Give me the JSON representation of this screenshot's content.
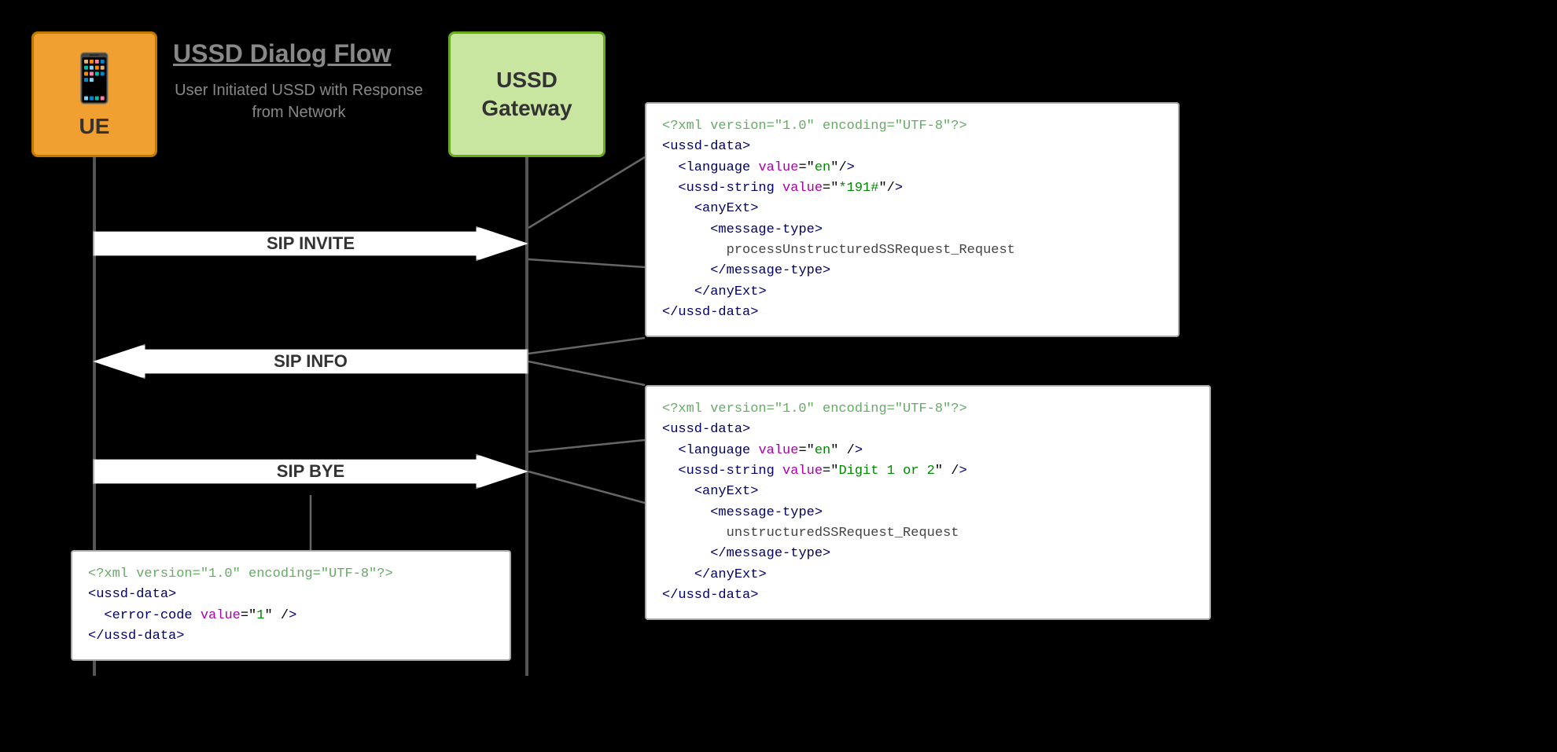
{
  "ue": {
    "label": "UE"
  },
  "title": {
    "main": "USSD Dialog Flow",
    "sub": "User Initiated USSD with Response from Network"
  },
  "gateway": {
    "label": "USSD\nGateway"
  },
  "arrows": {
    "sip_invite": "SIP INVITE",
    "sip_info": "SIP INFO",
    "sip_bye": "SIP BYE"
  },
  "xml_top": {
    "line1": "<?xml version=\"1.0\" encoding=\"UTF-8\"?>",
    "line2": "<ussd-data>",
    "line3": "  <language value=\"en\"/>",
    "line4": "  <ussd-string value=\"*191#\"/>",
    "line5": "    <anyExt>",
    "line6": "      <message-type>",
    "line7": "        processUnstructuredSSRequest_Request",
    "line8": "      </message-type>",
    "line9": "    </anyExt>",
    "line10": "</ussd-data>"
  },
  "xml_mid": {
    "line1": "<?xml version=\"1.0\" encoding=\"UTF-8\"?>",
    "line2": "<ussd-data>",
    "line3": "  <language value=\"en\" />",
    "line4": "  <ussd-string value=\"Digit 1 or 2\" />",
    "line5": "    <anyExt>",
    "line6": "      <message-type>",
    "line7": "        unstructuredSSRequest_Request",
    "line8": "      </message-type>",
    "line9": "    </anyExt>",
    "line10": "</ussd-data>"
  },
  "xml_bottom": {
    "line1": "<?xml version=\"1.0\" encoding=\"UTF-8\"?>",
    "line2": "<ussd-data>",
    "line3": "  <error-code value=\"1\" />",
    "line4": "</ussd-data>"
  }
}
